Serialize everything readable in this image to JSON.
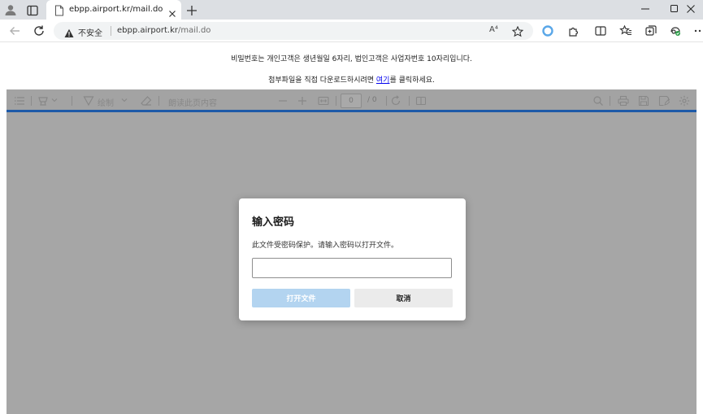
{
  "browser": {
    "tab_title": "ebpp.airport.kr/mail.do",
    "security_label": "不安全",
    "url_host": "ebpp.airport.kr",
    "url_path": "/mail.do",
    "read_aloud_label": "A⁴"
  },
  "page": {
    "notice_password": "비밀번호는 개인고객은 생년월일 6자리, 법인고객은 사업자번호 10자리입니다.",
    "notice_download_prefix": "첨부파일을 직접 다운로드하시려면 ",
    "notice_download_link": "여기",
    "notice_download_suffix": "를 클릭하세요."
  },
  "pdf_toolbar": {
    "draw_label": "绘制",
    "read_aloud_label": "朗读此页内容",
    "page_value": "0",
    "page_total": "/ 0"
  },
  "dialog": {
    "title": "输入密码",
    "message": "此文件受密码保护。请输入密码以打开文件。",
    "password_value": "",
    "open_button": "打开文件",
    "cancel_button": "取消"
  },
  "colors": {
    "accent_bar": "#1e5aa8",
    "open_button_bg": "#b3d4f0",
    "viewer_bg": "#a6a6a6"
  }
}
